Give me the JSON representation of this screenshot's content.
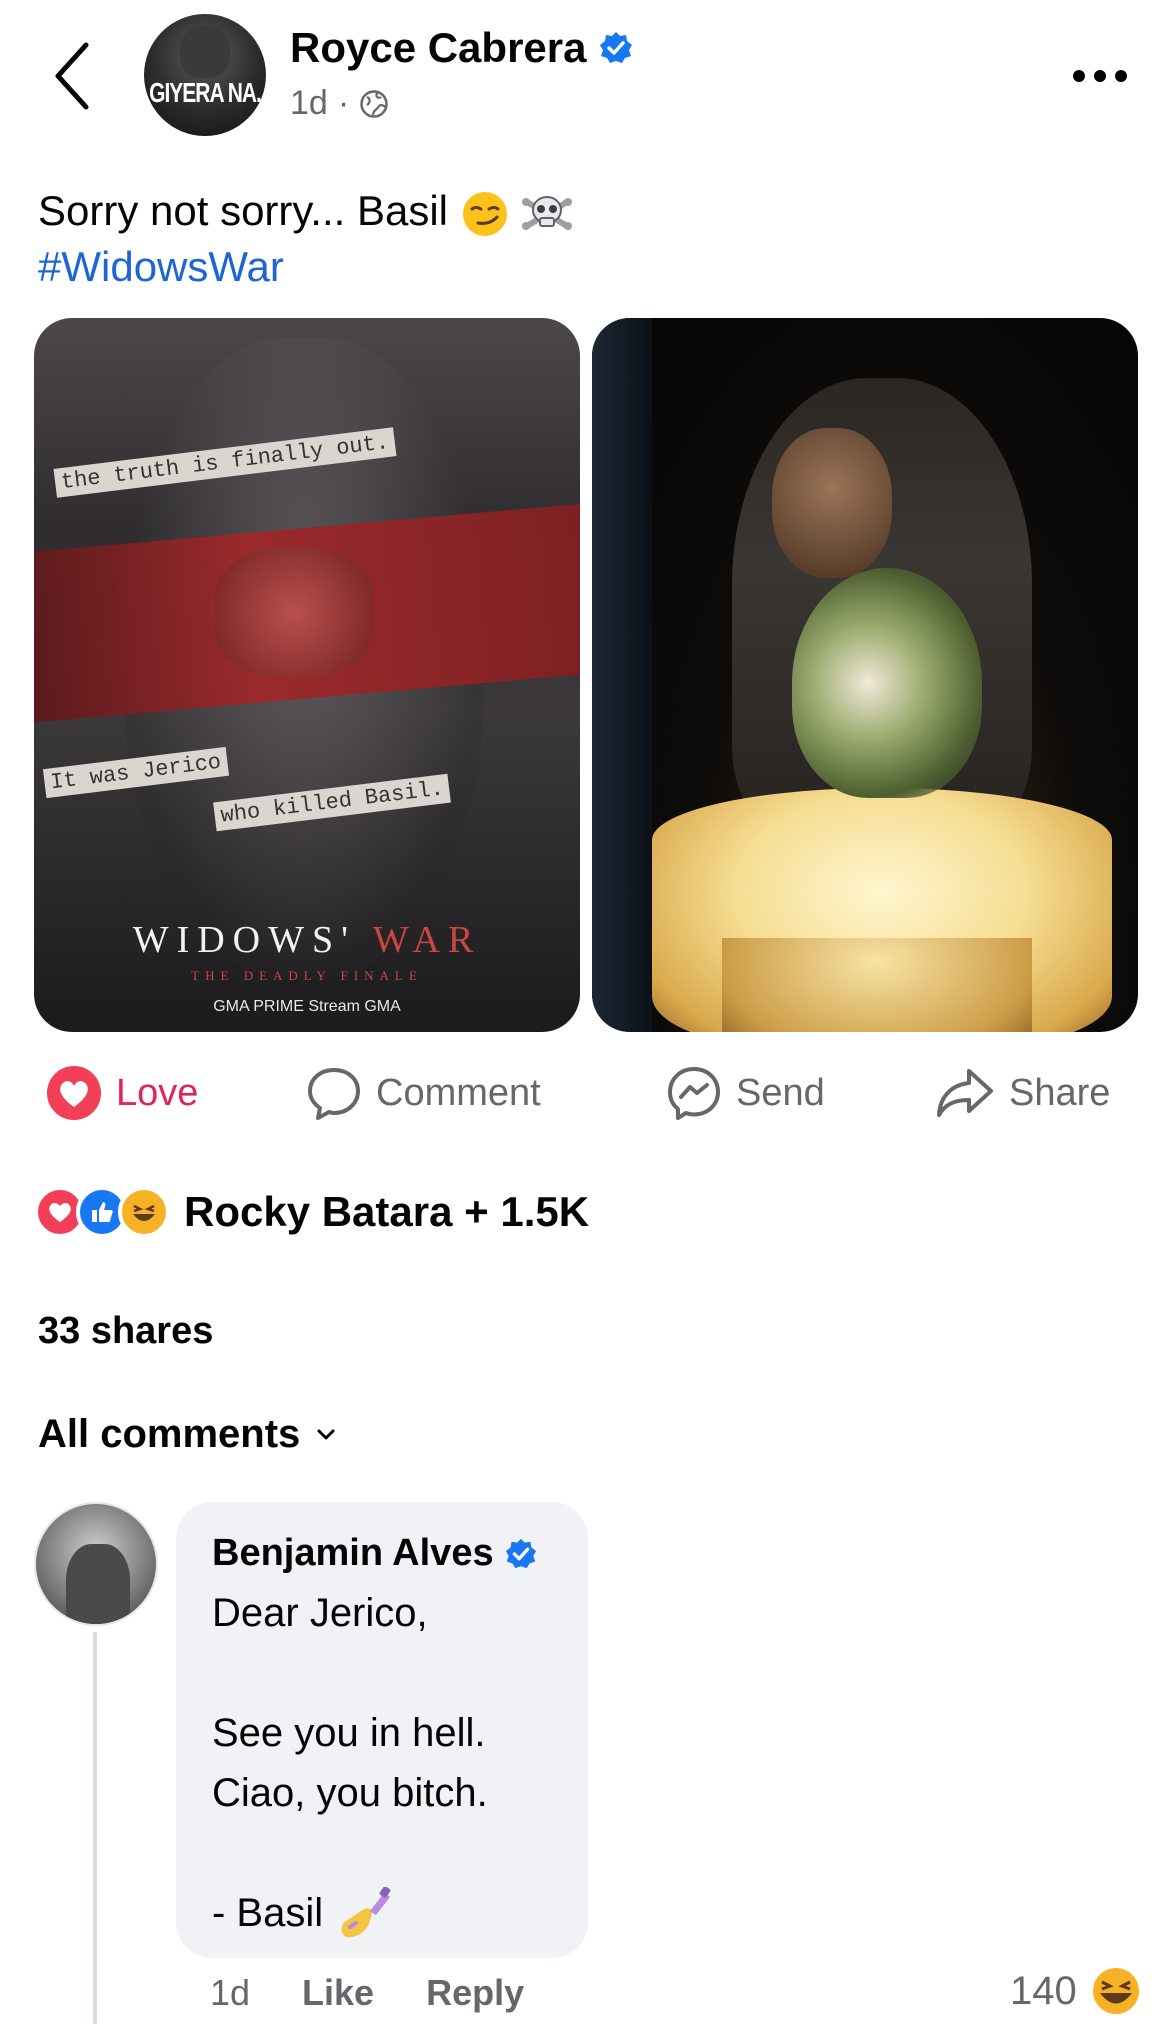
{
  "header": {
    "author": "Royce Cabrera",
    "time": "1d",
    "separator": "·",
    "avatar_text": "GIYERA NA."
  },
  "post": {
    "text": "Sorry not sorry... Basil",
    "hashtag": "#WidowsWar",
    "photo_left": {
      "caption_1": "the truth is finally out.",
      "caption_2": "It was Jerico",
      "caption_3": "who killed Basil.",
      "title_a": "WIDOWS'",
      "title_b": "WAR",
      "subtitle": "THE DEADLY FINALE",
      "logos": "GMA PRIME  Stream  GMA"
    }
  },
  "actions": {
    "love": "Love",
    "comment": "Comment",
    "send": "Send",
    "share": "Share"
  },
  "reactions": {
    "summary": "Rocky Batara + 1.5K"
  },
  "shares": "33 shares",
  "comments_filter": "All comments",
  "comment": {
    "author": "Benjamin Alves",
    "body": "Dear Jerico,\n\nSee you in hell.\nCiao, you bitch.\n\n- Basil",
    "time": "1d",
    "like": "Like",
    "reply": "Reply",
    "reaction_count": "140"
  },
  "colors": {
    "accent": "#1b65d6",
    "love": "#e0245e",
    "verified": "#1877f2",
    "muted": "#65676b",
    "bubble": "#f0f2f5"
  },
  "icons": [
    "chevron-left-icon",
    "verified-icon",
    "globe-icon",
    "more-icon",
    "heart-icon",
    "comment-icon",
    "messenger-icon",
    "share-icon",
    "chevron-down-icon",
    "smirk-emoji-icon",
    "skull-crossbones-icon",
    "nail-polish-emoji-icon",
    "haha-emoji-icon"
  ]
}
